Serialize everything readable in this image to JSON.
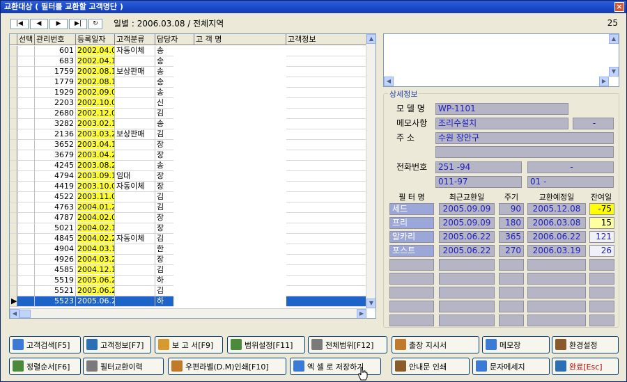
{
  "window": {
    "title": "교환대상 ( 필터를 교환할 고객명단 )",
    "close": "×"
  },
  "nav": {
    "first": "|◀",
    "prev": "◀",
    "next": "▶",
    "last": "▶|",
    "refresh": "↻"
  },
  "filter_label": "일별 : 2006.03.08 / 전체지역",
  "record_count": "25",
  "grid": {
    "headers": {
      "select": "선택",
      "num": "관리번호",
      "date": "등록일자",
      "type": "고객분류",
      "mgr": "담당자",
      "name": "고 객 명",
      "info": "고객정보"
    },
    "rows": [
      {
        "num": "601",
        "date": "2002.04.02",
        "type": "자동이체",
        "mgr": "송"
      },
      {
        "num": "683",
        "date": "2002.04.11",
        "type": "",
        "mgr": "송"
      },
      {
        "num": "1759",
        "date": "2002.08.14",
        "type": "보상판매",
        "mgr": "송"
      },
      {
        "num": "1779",
        "date": "2002.08.16",
        "type": "",
        "mgr": "송"
      },
      {
        "num": "1929",
        "date": "2002.09.02",
        "type": "",
        "mgr": "송"
      },
      {
        "num": "2203",
        "date": "2002.10.04",
        "type": "",
        "mgr": "신"
      },
      {
        "num": "2680",
        "date": "2002.12.05",
        "type": "",
        "mgr": "김"
      },
      {
        "num": "3282",
        "date": "2003.02.14",
        "type": "",
        "mgr": "송"
      },
      {
        "num": "2136",
        "date": "2003.03.27",
        "type": "보상판매",
        "mgr": "김"
      },
      {
        "num": "3652",
        "date": "2003.04.18",
        "type": "",
        "mgr": "장"
      },
      {
        "num": "3679",
        "date": "2003.04.25",
        "type": "",
        "mgr": "장"
      },
      {
        "num": "4245",
        "date": "2003.08.28",
        "type": "",
        "mgr": "송"
      },
      {
        "num": "4794",
        "date": "2003.09.15",
        "type": "임대",
        "mgr": "장"
      },
      {
        "num": "4419",
        "date": "2003.10.02",
        "type": "자동이체",
        "mgr": "장"
      },
      {
        "num": "4522",
        "date": "2003.11.03",
        "type": "",
        "mgr": "김"
      },
      {
        "num": "4763",
        "date": "2004.01.29",
        "type": "",
        "mgr": "김"
      },
      {
        "num": "4787",
        "date": "2004.02.03",
        "type": "",
        "mgr": "장"
      },
      {
        "num": "5021",
        "date": "2004.02.10",
        "type": "",
        "mgr": "장"
      },
      {
        "num": "4845",
        "date": "2004.02.21",
        "type": "자동이체",
        "mgr": "김"
      },
      {
        "num": "4904",
        "date": "2004.03.15",
        "type": "",
        "mgr": "한"
      },
      {
        "num": "4926",
        "date": "2004.03.25",
        "type": "",
        "mgr": "장"
      },
      {
        "num": "4585",
        "date": "2004.12.15",
        "type": "",
        "mgr": "김"
      },
      {
        "num": "5519",
        "date": "2005.06.20",
        "type": "",
        "mgr": "하"
      },
      {
        "num": "5521",
        "date": "2005.06.21",
        "type": "",
        "mgr": "김"
      },
      {
        "num": "5523",
        "date": "2005.06.22",
        "type": "",
        "mgr": "하"
      }
    ],
    "selected_row_marker": "▶",
    "scroll_up": "▲",
    "scroll_down": "▼",
    "scroll_left": "◀",
    "scroll_right": "▶"
  },
  "detail": {
    "legend": "상세정보",
    "model_label": "모 델 명",
    "model_value": "WP-1101",
    "memo_label": "메모사항",
    "memo_value": "조리수설치",
    "memo_extra": "-",
    "addr_label": "주    소",
    "addr_value": "수원 장안구",
    "addr_value2": "",
    "phone_label": "전화번호",
    "phone1": "251 -94",
    "phone2": "-",
    "phone3": "011-97",
    "phone4": "01 -",
    "filter_headers": {
      "name": "필 터 명",
      "recent": "최근교환일",
      "cycle": "주기",
      "planned": "교환예정일",
      "remain": "잔여일"
    },
    "filters": [
      {
        "name": "세드",
        "recent": "2005.09.09",
        "cycle": "90",
        "planned": "2005.12.08",
        "remain": "-75"
      },
      {
        "name": "프리",
        "recent": "2005.09.09",
        "cycle": "180",
        "planned": "2006.03.08",
        "remain": "15"
      },
      {
        "name": "알카리",
        "recent": "2005.06.22",
        "cycle": "365",
        "planned": "2006.06.22",
        "remain": "121"
      },
      {
        "name": "포스트",
        "recent": "2005.06.22",
        "cycle": "270",
        "planned": "2006.03.19",
        "remain": "26"
      }
    ]
  },
  "buttons": {
    "row1": [
      {
        "label": "고객검색[F5]",
        "icon": "user-search-icon"
      },
      {
        "label": "고객정보[F7]",
        "icon": "customer-card-icon"
      },
      {
        "label": "보 고 서[F9]",
        "icon": "report-icon"
      },
      {
        "label": "범위설정[F11]",
        "icon": "range-icon"
      },
      {
        "label": "전체범위[F12]",
        "icon": "all-range-icon"
      },
      {
        "label": "출장 지시서",
        "icon": "dispatch-icon"
      },
      {
        "label": "메모장",
        "icon": "notepad-icon"
      },
      {
        "label": "환경설정",
        "icon": "settings-icon"
      }
    ],
    "row2": [
      {
        "label": "정렬순서[F6]",
        "icon": "sort-icon"
      },
      {
        "label": "필터교환이력",
        "icon": "history-icon"
      },
      {
        "label": "우편라벨(D.M)인쇄[F10]",
        "icon": "mail-label-icon"
      },
      {
        "label": "엑 셀 로 저장하기",
        "icon": "excel-icon"
      },
      {
        "label": "안내문 인쇄",
        "icon": "printer-icon"
      },
      {
        "label": "문자메세지",
        "icon": "sms-icon"
      },
      {
        "label": "완료[Esc]",
        "icon": "exit-icon"
      }
    ]
  }
}
